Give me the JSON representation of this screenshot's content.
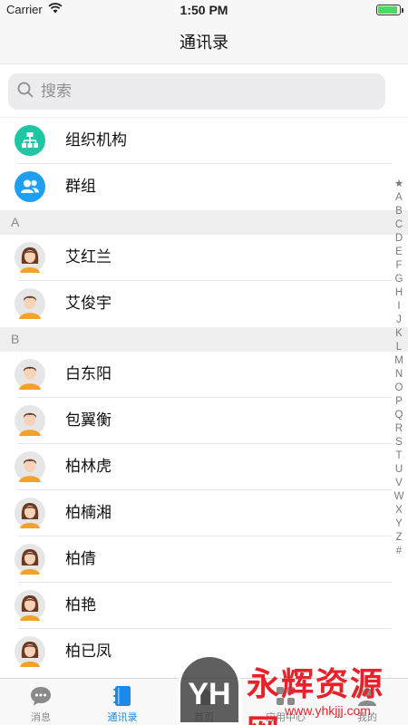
{
  "status_bar": {
    "carrier": "Carrier",
    "time": "1:50 PM",
    "battery_level": 0.9
  },
  "nav": {
    "title": "通讯录"
  },
  "search": {
    "placeholder": "搜索",
    "value": ""
  },
  "groups": [
    {
      "label": "组织机构",
      "icon": "org-chart-icon",
      "color": "#1ec6a3"
    },
    {
      "label": "群组",
      "icon": "group-people-icon",
      "color": "#1e9ff0"
    }
  ],
  "sections": [
    {
      "letter": "A",
      "contacts": [
        {
          "name": "艾红兰",
          "gender": "female"
        },
        {
          "name": "艾俊宇",
          "gender": "male"
        }
      ]
    },
    {
      "letter": "B",
      "contacts": [
        {
          "name": "白东阳",
          "gender": "male"
        },
        {
          "name": "包翼衡",
          "gender": "male"
        },
        {
          "name": "柏林虎",
          "gender": "male"
        },
        {
          "name": "柏楠湘",
          "gender": "female"
        },
        {
          "name": "柏倩",
          "gender": "female"
        },
        {
          "name": "柏艳",
          "gender": "female"
        },
        {
          "name": "柏已凤",
          "gender": "female"
        }
      ]
    }
  ],
  "index_letters": [
    "★",
    "A",
    "B",
    "C",
    "D",
    "E",
    "F",
    "G",
    "H",
    "I",
    "J",
    "K",
    "L",
    "M",
    "N",
    "O",
    "P",
    "Q",
    "R",
    "S",
    "T",
    "U",
    "V",
    "W",
    "X",
    "Y",
    "Z",
    "#"
  ],
  "tabs": [
    {
      "label": "消息",
      "icon": "chat-bubble-icon",
      "active": false
    },
    {
      "label": "通讯录",
      "icon": "address-book-icon",
      "active": true
    },
    {
      "label": "首页",
      "icon": "home-icon",
      "active": false
    },
    {
      "label": "应用中心",
      "icon": "apps-icon",
      "active": false
    },
    {
      "label": "我的",
      "icon": "profile-icon",
      "active": false
    }
  ],
  "colors": {
    "accent": "#1a8ae6",
    "section_bg": "#efefef",
    "watermark": "#e8222a"
  },
  "watermark": {
    "text": "永辉资源网",
    "url": "www.yhkjjj.com",
    "logo": "YH"
  }
}
